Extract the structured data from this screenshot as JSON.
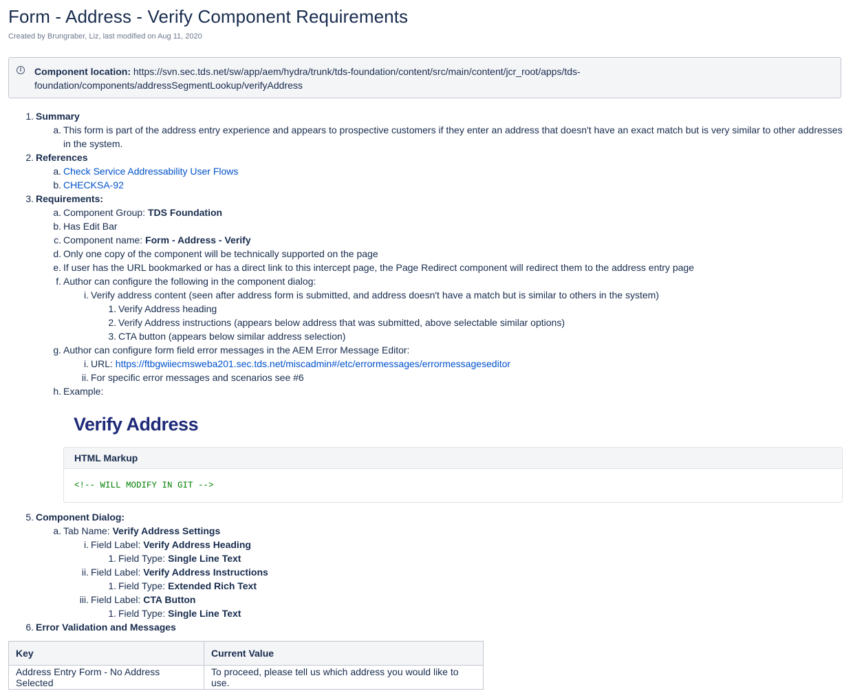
{
  "page": {
    "title": "Form - Address - Verify Component Requirements",
    "meta": "Created by Brungraber, Liz, last modified on Aug 11, 2020"
  },
  "info": {
    "icon": "info-icon",
    "label": "Component location:",
    "path_line1": "https://svn.sec.tds.net/sw/app/aem/hydra/trunk/tds-foundation/content/src/main/content/jcr_root/apps/tds-",
    "path_line2": "foundation/components/addressSegmentLookup/verifyAddress"
  },
  "summary": {
    "num": "1.",
    "heading": "Summary",
    "a_num": "a.",
    "a_line1": "This form is part of the address entry experience and appears to prospective customers if they enter an address that doesn't have an exact match but is very similar to other addresses",
    "a_line2": "in the system."
  },
  "references": {
    "num": "2.",
    "heading": "References",
    "a_num": "a.",
    "a_link": "Check Service Addressability User Flows",
    "b_num": "b.",
    "b_link": "CHECKSA-92"
  },
  "requirements": {
    "num": "3.",
    "heading": "Requirements:",
    "a_num": "a.",
    "a_text": "Component Group: ",
    "a_bold": "TDS Foundation",
    "b_num": "b.",
    "b_text": "Has Edit Bar",
    "c_num": "c.",
    "c_text": "Component name: ",
    "c_bold": "Form - Address - Verify",
    "d_num": "d.",
    "d_text": "Only one copy of the component will be technically supported on the page",
    "e_num": "e.",
    "e_text": "If user has the URL bookmarked or has a direct link to this intercept page, the Page Redirect component will redirect them to the address entry page",
    "f_num": "f.",
    "f_text": "Author can configure the following in the component dialog:",
    "fi_num": "i.",
    "fi_text": "Verify address content (seen after address form is submitted, and address doesn't have a match but is similar to others in the system)",
    "fi1_num": "1.",
    "fi1_text": "Verify Address heading",
    "fi2_num": "2.",
    "fi2_text": "Verify Address instructions (appears below address that was submitted, above selectable similar options)",
    "fi3_num": "3.",
    "fi3_text": "CTA button (appears below similar address selection)",
    "g_num": "g.",
    "g_text": "Author can configure form field error messages in the AEM Error Message Editor:",
    "gi_num": "i.",
    "gi_text": "URL: ",
    "gi_link": "https://ftbgwiiecmsweba201.sec.tds.net/miscadmin#/etc/errormessages/errormessageseditor",
    "gii_num": "ii.",
    "gii_text": "For specific error messages and scenarios see #6",
    "h_num": "h.",
    "h_text": "Example:"
  },
  "example": {
    "logo_text": "Verify Address",
    "code_title": "HTML Markup",
    "code_line": "<!-- WILL MODIFY IN GIT -->"
  },
  "dialog": {
    "num": "5.",
    "heading": "Component Dialog:",
    "a_num": "a.",
    "a_text": "Tab Name: ",
    "a_bold": "Verify Address Settings",
    "i_num": "i.",
    "i_text": "Field Label: ",
    "i_bold": "Verify Address Heading",
    "i1_num": "1.",
    "i1_text": "Field Type: ",
    "i1_bold": "Single Line Text",
    "ii_num": "ii.",
    "ii_text": "Field Label: ",
    "ii_bold": "Verify Address Instructions",
    "ii1_num": "1.",
    "ii1_text": "Field Type: ",
    "ii1_bold": "Extended Rich Text",
    "iii_num": "iii.",
    "iii_text": "Field Label: ",
    "iii_bold": "CTA Button",
    "iii1_num": "1.",
    "iii1_text": "Field Type: ",
    "iii1_bold": "Single Line Text"
  },
  "errors": {
    "num": "6.",
    "heading": "Error Validation and Messages",
    "columns": [
      "Key",
      "Current Value"
    ],
    "rows": [
      [
        "Address Entry Form - No Address Selected",
        "To proceed, please tell us which address you would like to use."
      ]
    ]
  }
}
